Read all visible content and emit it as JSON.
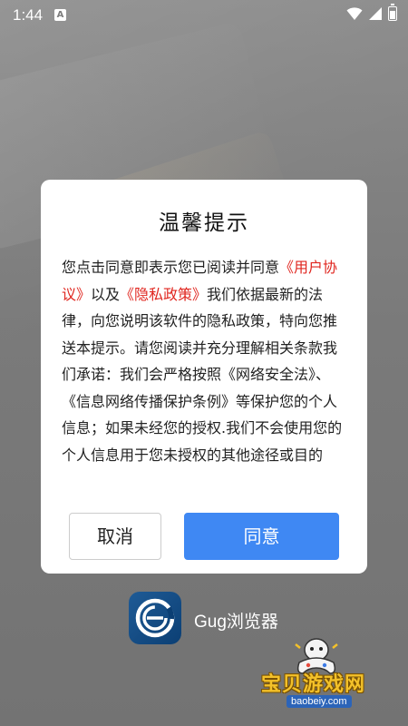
{
  "status_bar": {
    "time": "1:44",
    "notification_icon": "A"
  },
  "dialog": {
    "title": "温馨提示",
    "body": {
      "p1": "您点击同意即表示您已阅读并同意",
      "user_agreement": "《用户协议》",
      "p2": "以及",
      "privacy_policy": "《隐私政策》",
      "p3": "我们依据最新的法律，向您说明该软件的隐私政策，特向您推送本提示。请您阅读并充分理解相关条款我们承诺：我们会严格按照《网络安全法》、《信息网络传播保护条例》等保护您的个人信息；如果未经您的授权.我们不会使用您的个人信息用于您未授权的其他途径或目的"
    },
    "cancel_label": "取消",
    "agree_label": "同意",
    "link_color": "#e0261f",
    "agree_color": "#3f88f3"
  },
  "app": {
    "name": "Gug浏览器",
    "icon": "browser-e-logo"
  },
  "watermark": {
    "text": "宝贝游戏网",
    "url": "baobeiy.com",
    "icon": "gamepad-mascot"
  }
}
